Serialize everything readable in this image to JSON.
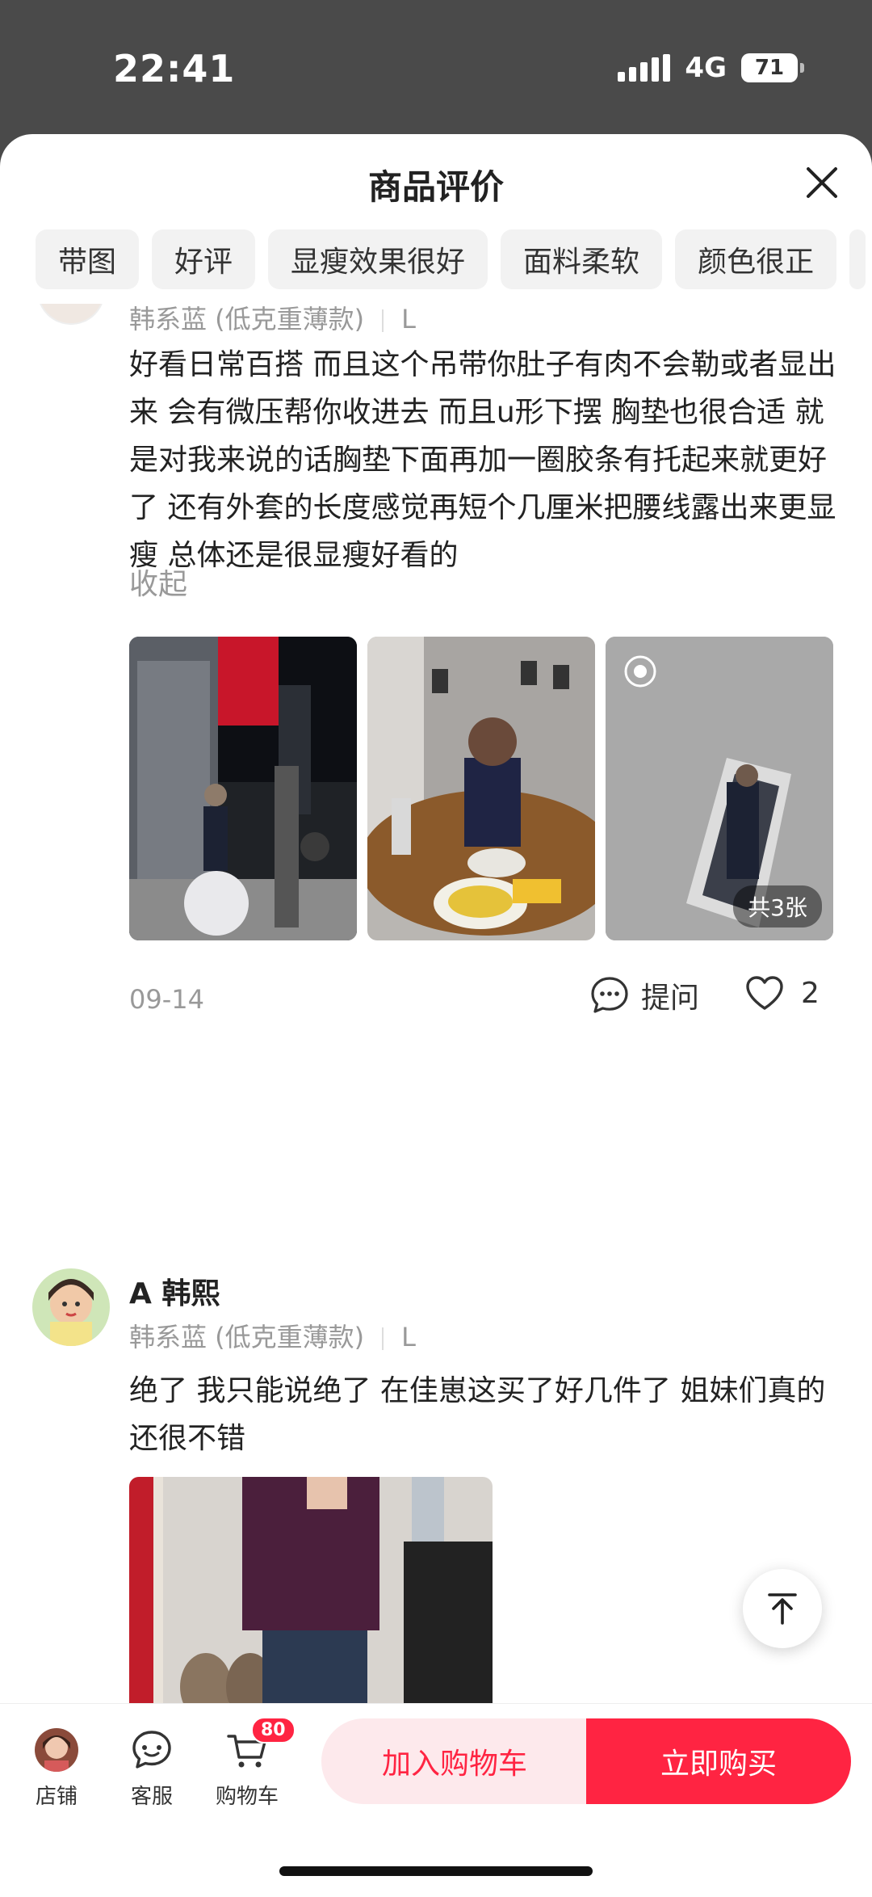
{
  "status_bar": {
    "time": "22:41",
    "network": "4G",
    "battery": "71"
  },
  "sheet": {
    "title": "商品评价",
    "tags": [
      "带图",
      "好评",
      "显瘦效果很好",
      "面料柔软",
      "颜色很正"
    ]
  },
  "reviews": [
    {
      "variant": "韩系蓝 (低克重薄款)",
      "size": "L",
      "text": "好看日常百搭 而且这个吊带你肚子有肉不会勒或者显出来 会有微压帮你收进去 而且u形下摆 胸垫也很合适 就是对我来说的话胸垫下面再加一圈胶条有托起来就更好了 还有外套的长度感觉再短个几厘米把腰线露出来更显瘦 总体还是很显瘦好看的",
      "collapse_label": "收起",
      "photo_count_label": "共3张",
      "date": "09-14",
      "ask_label": "提问",
      "likes": "2"
    },
    {
      "author": "A 韩熙",
      "variant": "韩系蓝 (低克重薄款)",
      "size": "L",
      "text": "绝了 我只能说绝了 在佳崽这买了好几件了 姐妹们真的还很不错"
    }
  ],
  "bottom_bar": {
    "shop_label": "店铺",
    "service_label": "客服",
    "cart_label": "购物车",
    "cart_badge": "80",
    "add_to_cart": "加入购物车",
    "buy_now": "立即购买"
  },
  "colors": {
    "accent": "#ff2442",
    "accent_light": "#fde9ec"
  }
}
